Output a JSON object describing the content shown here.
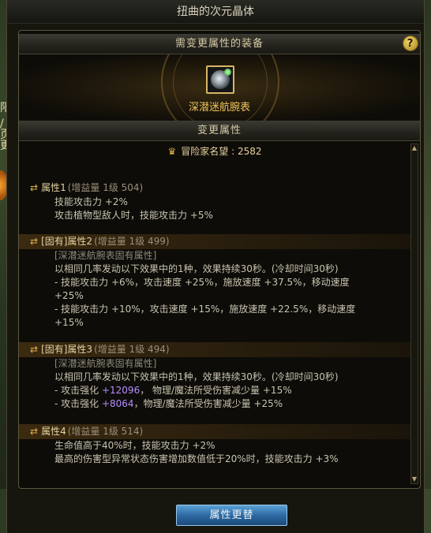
{
  "window": {
    "title": "扭曲的次元晶体"
  },
  "background": {
    "edge_texts": [
      "阳",
      "/",
      "页",
      "更"
    ]
  },
  "panel": {
    "header_top": "需变更属性的装备",
    "help_label": "?",
    "equipment": {
      "name": "深潜迷航腕表",
      "icon": "wristwatch-icon"
    },
    "header_mid": "变更属性"
  },
  "content": {
    "fame": {
      "label": "冒险家名望",
      "sep": " : ",
      "value": "2582"
    },
    "attributes": [
      {
        "title": "属性1",
        "meta": "(增益量 1级 504)",
        "lines": [
          "技能攻击力 +2%",
          "攻击植物型敌人时，技能攻击力 +5%"
        ]
      },
      {
        "title": "[固有]属性2",
        "meta": "(增益量 1级 499)",
        "sub": "[深潜迷航腕表固有属性]",
        "lines": [
          "以相同几率发动以下效果中的1种，效果持续30秒。(冷却时间30秒)",
          "- 技能攻击力 +6%，攻击速度 +25%，施放速度 +37.5%，移动速度",
          "+25%",
          "- 技能攻击力 +10%，攻击速度 +15%，施放速度 +22.5%，移动速度",
          "+15%"
        ]
      },
      {
        "title": "[固有]属性3",
        "meta": "(增益量 1级 494)",
        "sub": "[深潜迷航腕表固有属性]",
        "lines": [
          "以相同几率发动以下效果中的1种，效果持续30秒。(冷却时间30秒)"
        ],
        "rich_lines": [
          {
            "pre": "- 攻击强化 ",
            "value": "+12096",
            "post": "， 物理/魔法所受伤害减少量 +15%"
          },
          {
            "pre": "- 攻击强化 ",
            "value": "+8064",
            "post": "，物理/魔法所受伤害减少量 +25%"
          }
        ]
      },
      {
        "title": "属性4",
        "meta": "(增益量 1级 514)",
        "lines": [
          "生命值高于40%时，技能攻击力 +2%",
          "最高的伤害型异常状态伤害增加数值低于20%时，技能攻击力 +3%"
        ]
      }
    ]
  },
  "footer": {
    "button_label": "属性更替"
  },
  "colors": {
    "accent_gold": "#f0c45c",
    "highlight_purple": "#b58cff",
    "button_blue": "#2d6aa3"
  }
}
